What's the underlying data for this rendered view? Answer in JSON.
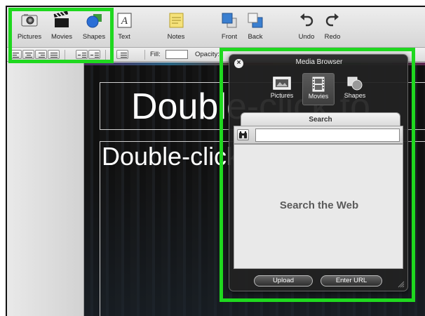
{
  "toolbar": {
    "items": [
      {
        "label": "Pictures",
        "icon": "camera-icon"
      },
      {
        "label": "Movies",
        "icon": "clapperboard-icon"
      },
      {
        "label": "Shapes",
        "icon": "shapes-icon"
      },
      {
        "label": "Text",
        "icon": "text-box-icon"
      },
      {
        "label": "Notes",
        "icon": "sticky-note-icon"
      },
      {
        "label": "Front",
        "icon": "bring-to-front-icon"
      },
      {
        "label": "Back",
        "icon": "send-to-back-icon"
      },
      {
        "label": "Undo",
        "icon": "undo-arrow-icon"
      },
      {
        "label": "Redo",
        "icon": "redo-arrow-icon"
      }
    ]
  },
  "format_bar": {
    "fill_label": "Fill:",
    "opacity_label": "Opacity:",
    "fill_color": "#ffffff"
  },
  "slide": {
    "title": "Double-click to",
    "body": "Double-click to"
  },
  "media_browser": {
    "title": "Media Browser",
    "tabs": [
      {
        "label": "Pictures",
        "icon": "picture-frame-icon",
        "active": false
      },
      {
        "label": "Movies",
        "icon": "film-strip-icon",
        "active": true
      },
      {
        "label": "Shapes",
        "icon": "shapes-icon",
        "active": false
      }
    ],
    "search_tab_label": "Search",
    "search_value": "",
    "results_message": "Search the Web",
    "buttons": {
      "upload": "Upload",
      "enter_url": "Enter URL"
    }
  },
  "colors": {
    "highlight": "#1fd81f",
    "slide_bg": "#111111",
    "panel_bg": "#222222"
  }
}
